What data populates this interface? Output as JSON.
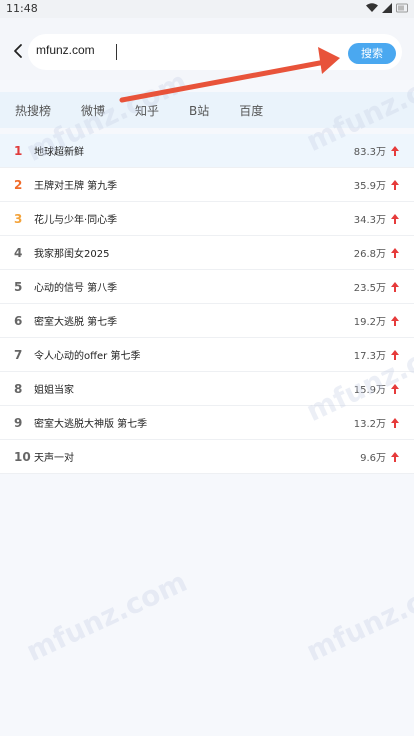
{
  "status": {
    "time": "11:48"
  },
  "search": {
    "value": "mfunz.com",
    "button_label": "搜索"
  },
  "tabs": [
    "热搜榜",
    "微博",
    "知乎",
    "B站",
    "百度"
  ],
  "list": [
    {
      "rank": "1",
      "title": "地球超新鲜",
      "count": "83.3万"
    },
    {
      "rank": "2",
      "title": "王牌对王牌 第九季",
      "count": "35.9万"
    },
    {
      "rank": "3",
      "title": "花儿与少年·同心季",
      "count": "34.3万"
    },
    {
      "rank": "4",
      "title": "我家那闺女2025",
      "count": "26.8万"
    },
    {
      "rank": "5",
      "title": "心动的信号 第八季",
      "count": "23.5万"
    },
    {
      "rank": "6",
      "title": "密室大逃脱 第七季",
      "count": "19.2万"
    },
    {
      "rank": "7",
      "title": "令人心动的offer 第七季",
      "count": "17.3万"
    },
    {
      "rank": "8",
      "title": "姐姐当家",
      "count": "15.9万"
    },
    {
      "rank": "9",
      "title": "密室大逃脱大神版 第七季",
      "count": "13.2万"
    },
    {
      "rank": "10",
      "title": "天声一对",
      "count": "9.6万"
    }
  ],
  "watermark": "mfunz.com",
  "colors": {
    "accent": "#4aa8f0",
    "up_arrow": "#e63b3b",
    "annotation_arrow": "#e8533a"
  }
}
